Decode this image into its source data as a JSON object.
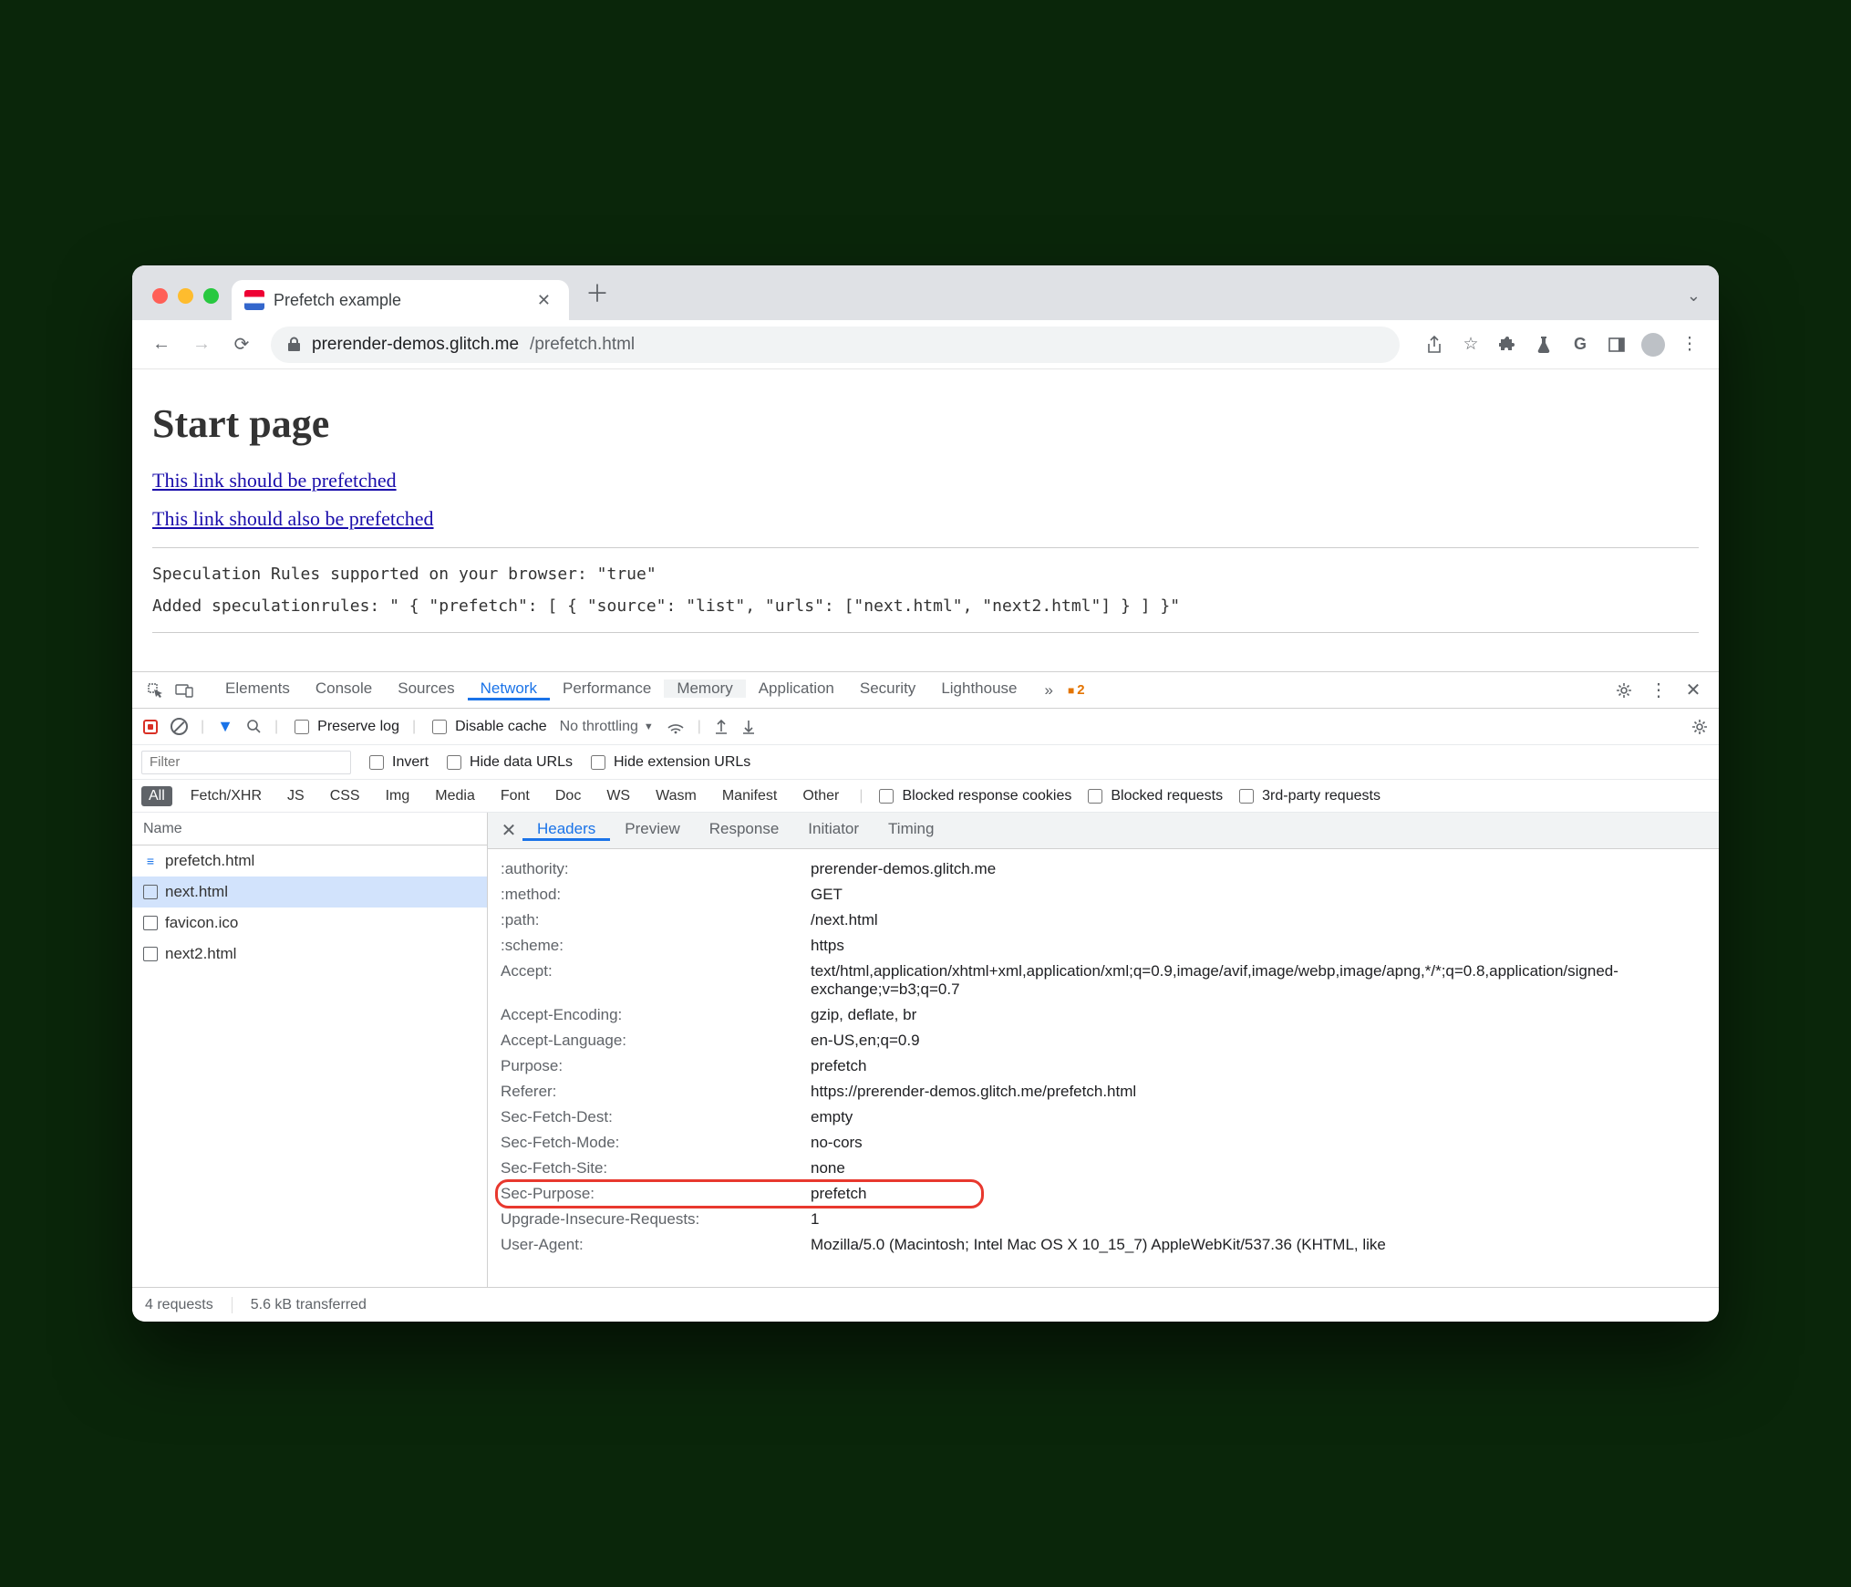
{
  "window": {
    "tab_title": "Prefetch example",
    "url_host": "prerender-demos.glitch.me",
    "url_path": "/prefetch.html"
  },
  "page": {
    "heading": "Start page",
    "link1": "This link should be prefetched",
    "link2": "This link should also be prefetched",
    "status_line1": "Speculation Rules supported on your browser: \"true\"",
    "status_line2": "Added speculationrules: \" { \"prefetch\": [ { \"source\": \"list\", \"urls\": [\"next.html\", \"next2.html\"] } ] }\""
  },
  "devtools": {
    "panels": [
      "Elements",
      "Console",
      "Sources",
      "Network",
      "Performance",
      "Memory",
      "Application",
      "Security",
      "Lighthouse"
    ],
    "active_panel": "Network",
    "issues_count": "2",
    "toolbar": {
      "preserve_log": "Preserve log",
      "disable_cache": "Disable cache",
      "throttling": "No throttling"
    },
    "filterbar": {
      "filter_placeholder": "Filter",
      "invert": "Invert",
      "hide_data": "Hide data URLs",
      "hide_ext": "Hide extension URLs"
    },
    "types": [
      "All",
      "Fetch/XHR",
      "JS",
      "CSS",
      "Img",
      "Media",
      "Font",
      "Doc",
      "WS",
      "Wasm",
      "Manifest",
      "Other"
    ],
    "type_checks": {
      "blocked_cookies": "Blocked response cookies",
      "blocked_requests": "Blocked requests",
      "third_party": "3rd-party requests"
    },
    "name_header": "Name",
    "requests": [
      {
        "name": "prefetch.html",
        "icon": "doc"
      },
      {
        "name": "next.html",
        "icon": "outline",
        "selected": true
      },
      {
        "name": "favicon.ico",
        "icon": "outline"
      },
      {
        "name": "next2.html",
        "icon": "outline"
      }
    ],
    "detail_tabs": [
      "Headers",
      "Preview",
      "Response",
      "Initiator",
      "Timing"
    ],
    "active_detail_tab": "Headers",
    "headers": [
      {
        "k": ":authority:",
        "v": "prerender-demos.glitch.me"
      },
      {
        "k": ":method:",
        "v": "GET"
      },
      {
        "k": ":path:",
        "v": "/next.html"
      },
      {
        "k": ":scheme:",
        "v": "https"
      },
      {
        "k": "Accept:",
        "v": "text/html,application/xhtml+xml,application/xml;q=0.9,image/avif,image/webp,image/apng,*/*;q=0.8,application/signed-exchange;v=b3;q=0.7"
      },
      {
        "k": "Accept-Encoding:",
        "v": "gzip, deflate, br"
      },
      {
        "k": "Accept-Language:",
        "v": "en-US,en;q=0.9"
      },
      {
        "k": "Purpose:",
        "v": "prefetch"
      },
      {
        "k": "Referer:",
        "v": "https://prerender-demos.glitch.me/prefetch.html"
      },
      {
        "k": "Sec-Fetch-Dest:",
        "v": "empty"
      },
      {
        "k": "Sec-Fetch-Mode:",
        "v": "no-cors"
      },
      {
        "k": "Sec-Fetch-Site:",
        "v": "none"
      },
      {
        "k": "Sec-Purpose:",
        "v": "prefetch",
        "highlight": true
      },
      {
        "k": "Upgrade-Insecure-Requests:",
        "v": "1"
      },
      {
        "k": "User-Agent:",
        "v": "Mozilla/5.0 (Macintosh; Intel Mac OS X 10_15_7) AppleWebKit/537.36 (KHTML, like"
      }
    ],
    "status": {
      "reqs": "4 requests",
      "transferred": "5.6 kB transferred"
    }
  }
}
